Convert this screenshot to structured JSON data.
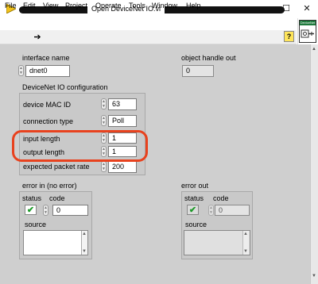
{
  "window": {
    "title": "Open DeviceNet IO.vi",
    "controls": {
      "minimize": "—",
      "maximize": "☐",
      "close": "✕"
    }
  },
  "menu": [
    "File",
    "Edit",
    "View",
    "Project",
    "Operate",
    "Tools",
    "Window",
    "Help"
  ],
  "toolbar": {
    "run_icon": "run-arrow-icon",
    "help_label": "?"
  },
  "vi_icon": {
    "label": "DeviceNet"
  },
  "panel": {
    "interface_name": {
      "label": "interface name",
      "value": "dnet0"
    },
    "object_handle_out": {
      "label": "object handle out",
      "value": "0"
    },
    "config": {
      "label": "DeviceNet IO configuration",
      "rows": [
        {
          "label": "device MAC ID",
          "value": "63"
        },
        {
          "label": "connection type",
          "value": "Poll"
        },
        {
          "label": "input length",
          "value": "1"
        },
        {
          "label": "output length",
          "value": "1"
        },
        {
          "label": "expected packet rate",
          "value": "200"
        }
      ]
    },
    "error_in": {
      "label": "error in (no error)",
      "status_label": "status",
      "code_label": "code",
      "code_value": "0",
      "source_label": "source",
      "status_ok": true
    },
    "error_out": {
      "label": "error out",
      "status_label": "status",
      "code_label": "code",
      "code_value": "0",
      "source_label": "source",
      "status_ok": true
    }
  },
  "colors": {
    "panel_bg": "#cfcfcf",
    "highlight": "#e8421e",
    "check": "#1c9a28"
  }
}
